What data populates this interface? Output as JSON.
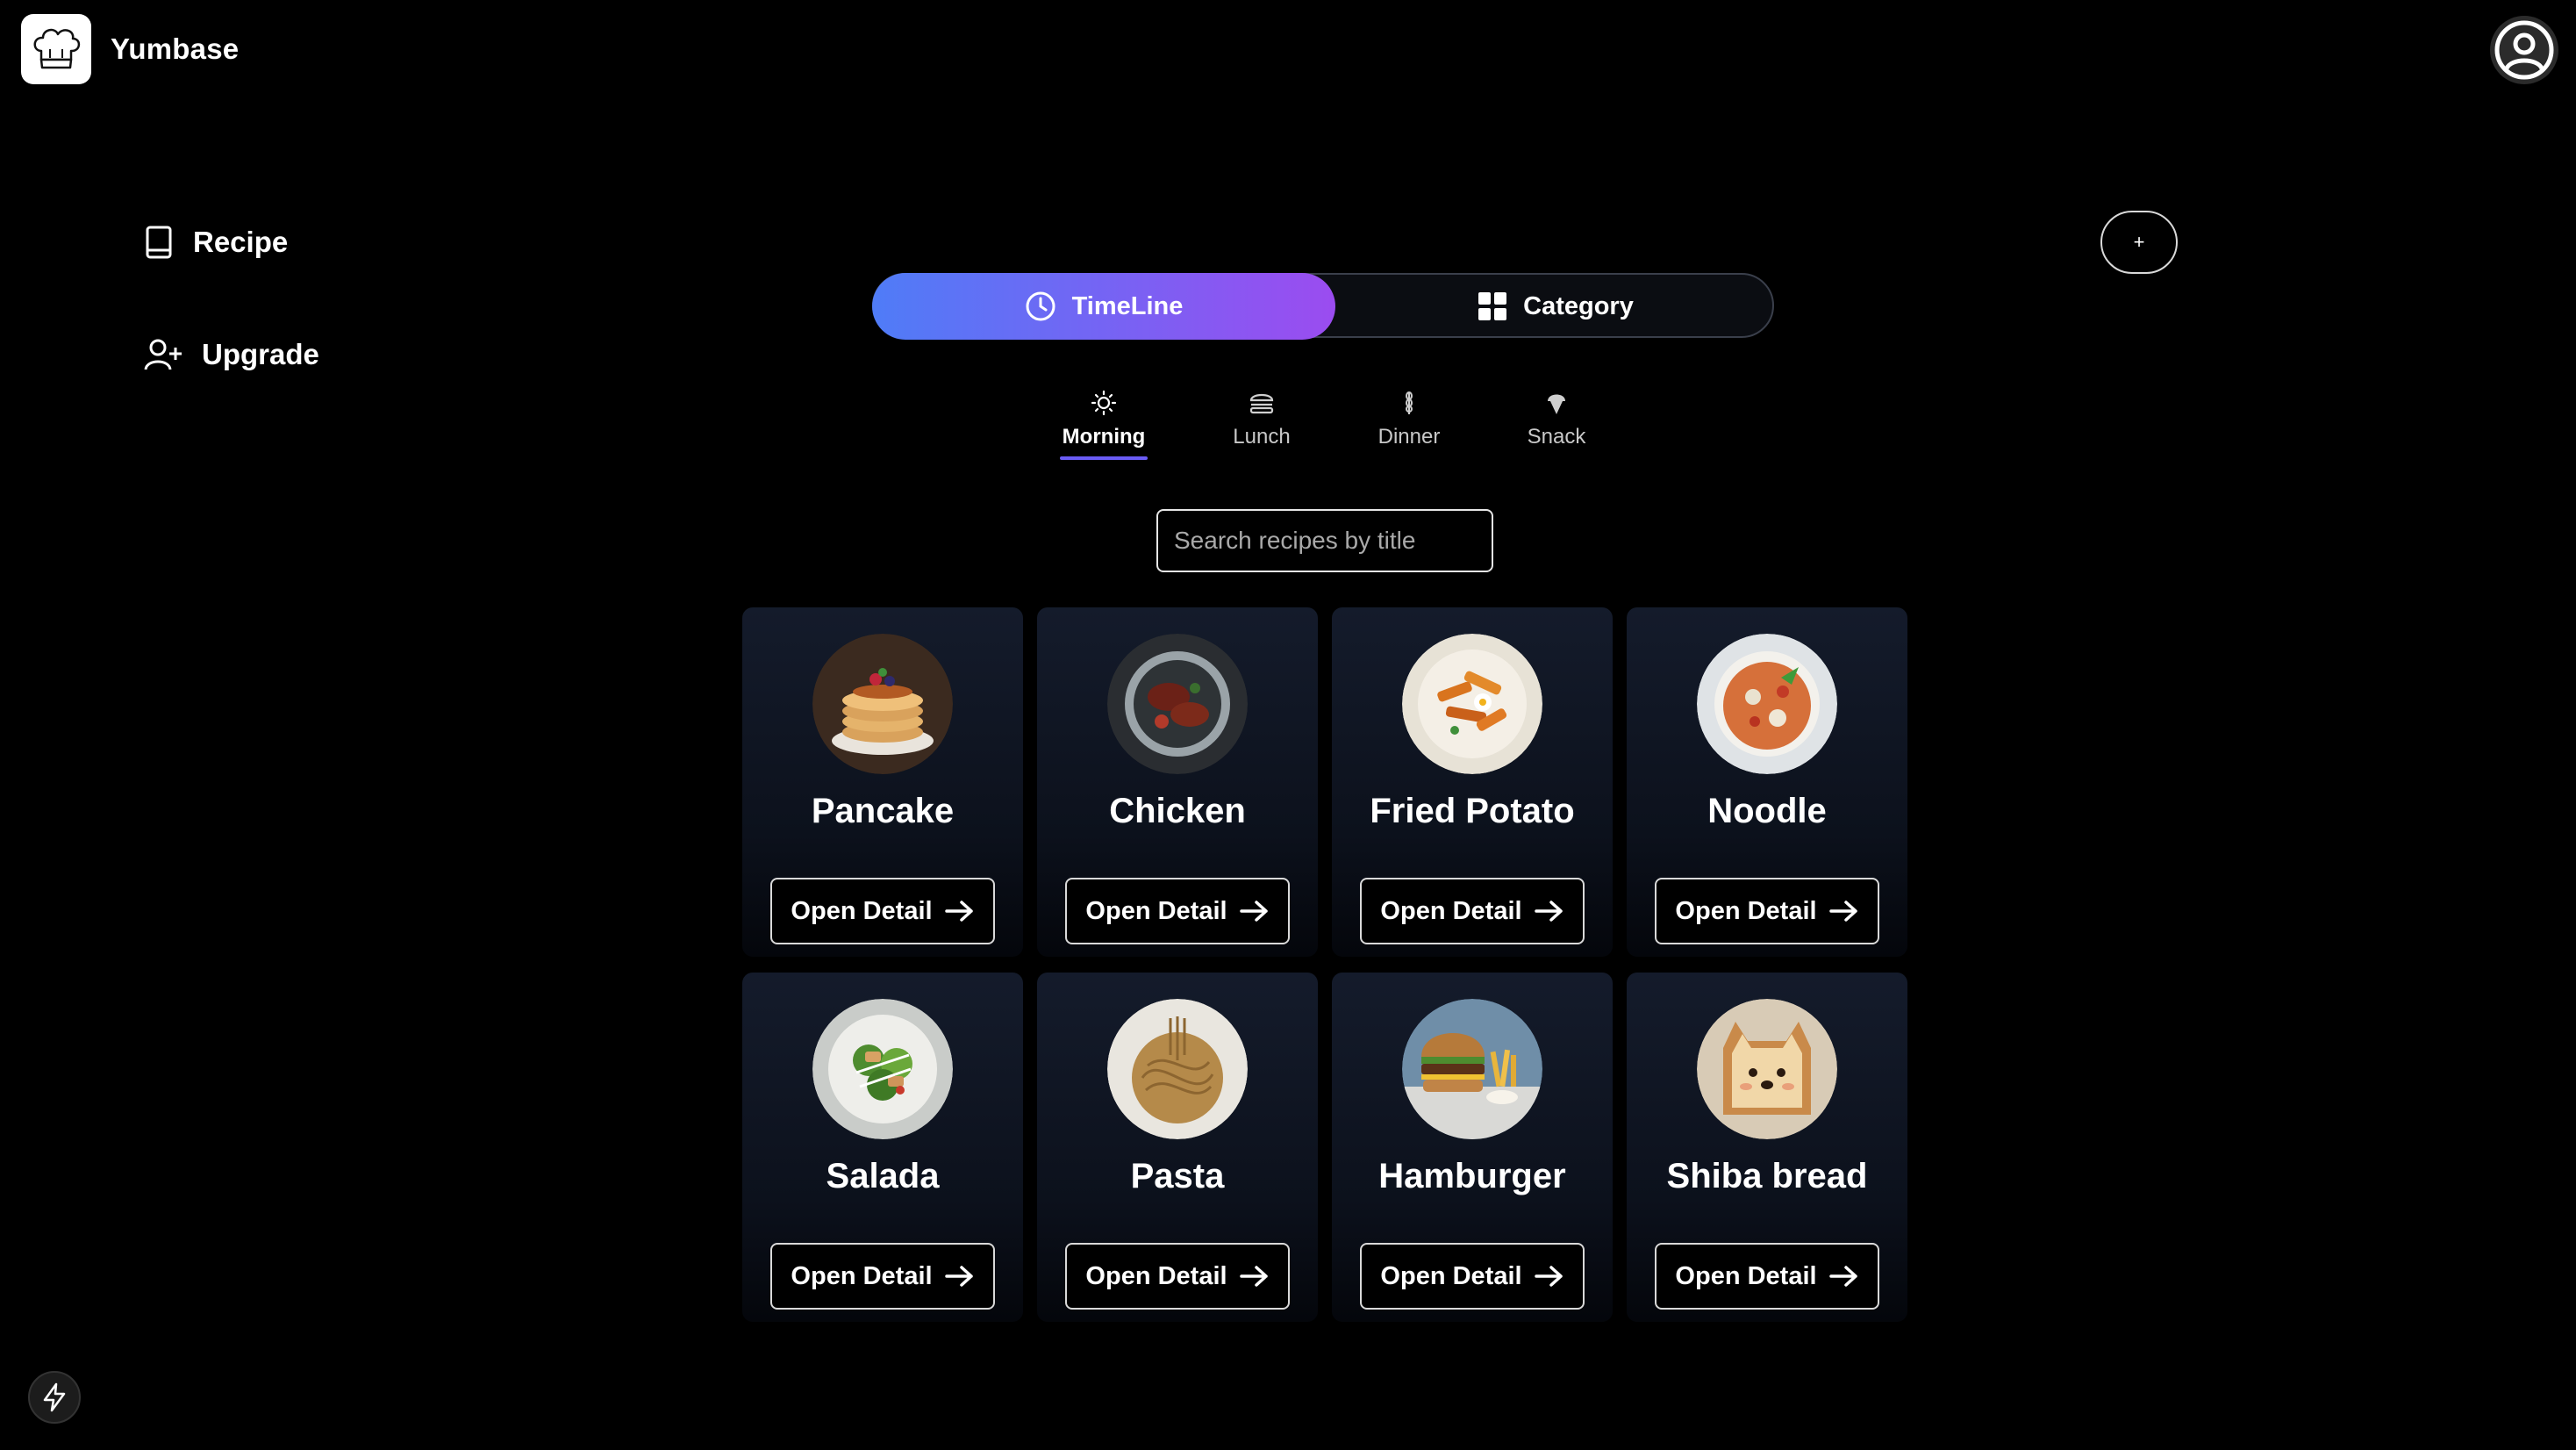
{
  "app": {
    "name": "Yumbase"
  },
  "sidebar": {
    "items": [
      {
        "label": "Recipe",
        "icon": "book-icon"
      },
      {
        "label": "Upgrade",
        "icon": "user-plus-icon"
      }
    ]
  },
  "add_button": {
    "label": "+"
  },
  "view_toggle": {
    "options": [
      {
        "label": "TimeLine",
        "icon": "clock-icon",
        "active": true
      },
      {
        "label": "Category",
        "icon": "grid-icon",
        "active": false
      }
    ]
  },
  "meal_tabs": [
    {
      "label": "Morning",
      "icon": "sun-icon",
      "active": true
    },
    {
      "label": "Lunch",
      "icon": "burger-icon",
      "active": false
    },
    {
      "label": "Dinner",
      "icon": "wheat-icon",
      "active": false
    },
    {
      "label": "Snack",
      "icon": "ice-cream-icon",
      "active": false
    }
  ],
  "search": {
    "placeholder": "Search recipes by title",
    "value": ""
  },
  "recipes": [
    {
      "title": "Pancake",
      "button": "Open Detail"
    },
    {
      "title": "Chicken",
      "button": "Open Detail"
    },
    {
      "title": "Fried Potato",
      "button": "Open Detail"
    },
    {
      "title": "Noodle",
      "button": "Open Detail"
    },
    {
      "title": "Salada",
      "button": "Open Detail"
    },
    {
      "title": "Pasta",
      "button": "Open Detail"
    },
    {
      "title": "Hamburger",
      "button": "Open Detail"
    },
    {
      "title": "Shiba bread",
      "button": "Open Detail"
    }
  ],
  "colors": {
    "background": "#000000",
    "accent_start": "#4f7cf7",
    "accent_end": "#9b4cf0",
    "tab_underline": "#6a5cf5",
    "card": "#141b2b"
  }
}
